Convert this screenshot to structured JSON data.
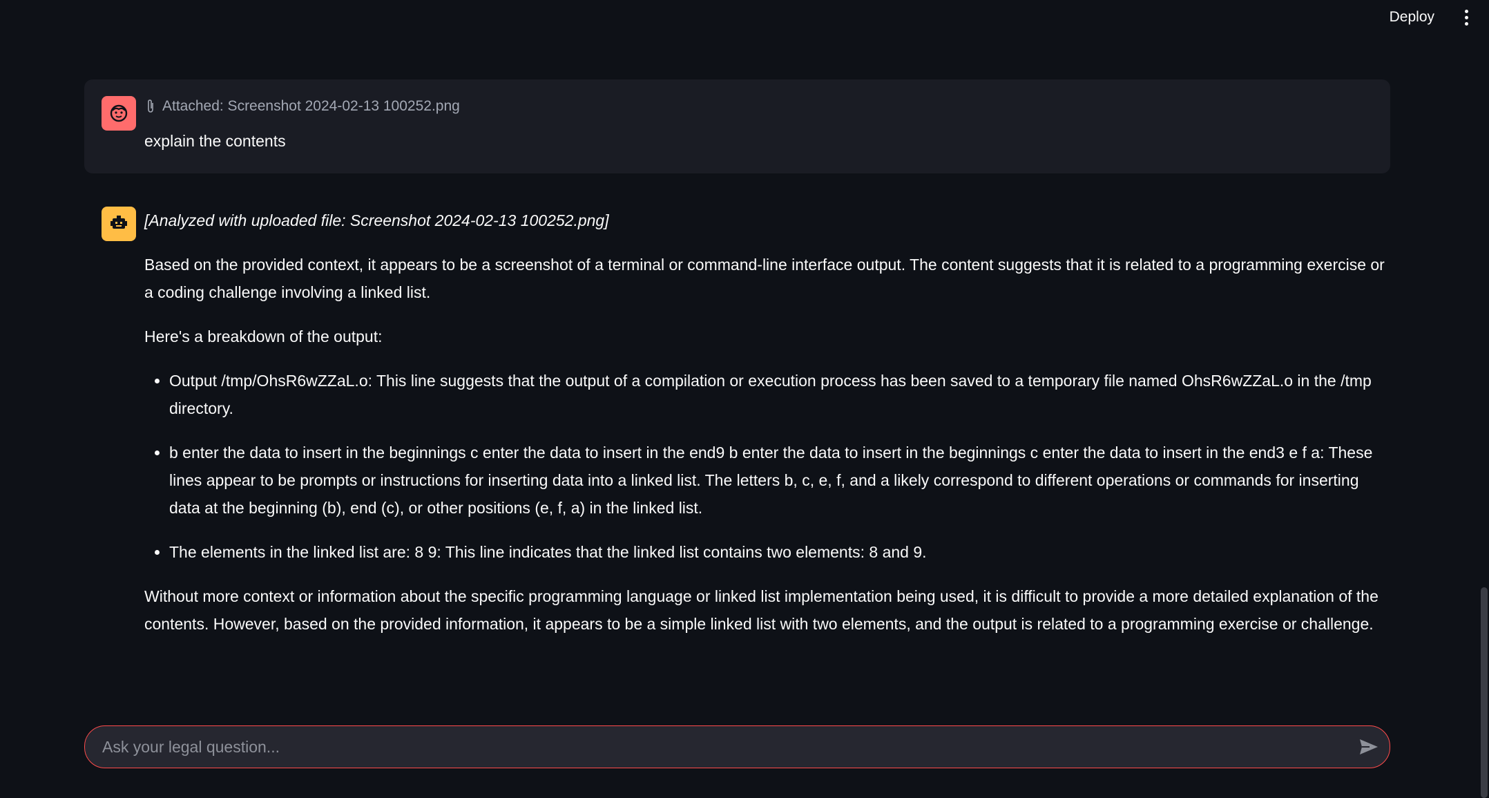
{
  "header": {
    "deploy_label": "Deploy"
  },
  "messages": {
    "user": {
      "attachment": "Attached: Screenshot 2024-02-13 100252.png",
      "text": "explain the contents"
    },
    "assistant": {
      "note": "[Analyzed with uploaded file: Screenshot 2024-02-13 100252.png]",
      "intro": "Based on the provided context, it appears to be a screenshot of a terminal or command-line interface output. The content suggests that it is related to a programming exercise or a coding challenge involving a linked list.",
      "breakdown_heading": "Here's a breakdown of the output:",
      "bullets": [
        "Output /tmp/OhsR6wZZaL.o: This line suggests that the output of a compilation or execution process has been saved to a temporary file named OhsR6wZZaL.o in the /tmp directory.",
        "b enter the data to insert in the beginnings c enter the data to insert in the end9 b enter the data to insert in the beginnings c enter the data to insert in the end3 e f a: These lines appear to be prompts or instructions for inserting data into a linked list. The letters b, c, e, f, and a likely correspond to different operations or commands for inserting data at the beginning (b), end (c), or other positions (e, f, a) in the linked list.",
        "The elements in the linked list are: 8 9: This line indicates that the linked list contains two elements: 8 and 9."
      ],
      "conclusion": "Without more context or information about the specific programming language or linked list implementation being used, it is difficult to provide a more detailed explanation of the contents. However, based on the provided information, it appears to be a simple linked list with two elements, and the output is related to a programming exercise or challenge."
    }
  },
  "input": {
    "placeholder": "Ask your legal question..."
  },
  "icons": {
    "user_avatar": "smiley-face-icon",
    "bot_avatar": "robot-icon",
    "attachment": "paperclip-icon",
    "send": "send-arrow-icon",
    "menu": "vertical-dots-icon"
  },
  "colors": {
    "background": "#0e1117",
    "user_avatar": "#ff6c6c",
    "bot_avatar": "#ffbd45",
    "input_border": "#ff4b4b"
  }
}
